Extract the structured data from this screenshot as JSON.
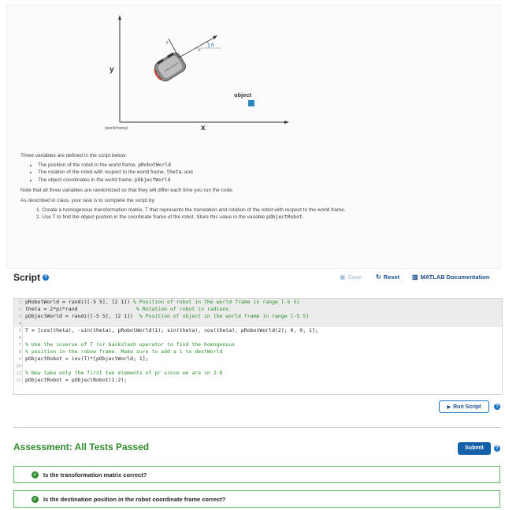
{
  "diagram": {
    "y_axis_label": "y",
    "x_axis_label": "x",
    "world_frame_label": "(world frame)",
    "object_label": "object",
    "robot_label": "(robot frame)",
    "theta_symbol": "θ",
    "robot_y_label": "y",
    "robot_x_label": "x"
  },
  "intro": {
    "p1": "Three variables are defined in the script below:",
    "bullets": [
      {
        "text": "The position of the robot in the world frame, ",
        "code": "pRobotWorld",
        "tail": ""
      },
      {
        "text": "The rotation of the robot with respect to the world frame, ",
        "code": "theta",
        "tail": ", and"
      },
      {
        "text": "The object coordinates in the world frame, ",
        "code": "pObjectWorld",
        "tail": ""
      }
    ],
    "p2": "Note that all three variables are randomized so that they will differ each time you run the code.",
    "p3": "As described in class, your task is to complete the script by:",
    "steps": [
      {
        "n": "1.",
        "text": "Create a homogenous transformation matrix, ",
        "code": "T",
        "tail": " that represents the translation and rotation of the robot with respect to the world frame."
      },
      {
        "n": "2.",
        "text": "Use ",
        "code": "T",
        "tail": " to find the object postion in the coordinate frame of the robot. Store this value in the variable ",
        "code2": "pObjectRobot",
        "tail2": "."
      }
    ]
  },
  "script": {
    "title": "Script",
    "save_label": "Save",
    "reset_label": "Reset",
    "doc_label": "MATLAB Documentation",
    "run_label": "Run Script",
    "lines": [
      {
        "n": "1",
        "code": "pRobotWorld = randi([-5 5], [2 1]) ",
        "comment": "% Position of robot in the world frame in range [-5 5]",
        "locked": true
      },
      {
        "n": "2",
        "code": "theta = 2*pi*rand                   ",
        "comment": "% Rotation of robot in radians",
        "locked": true
      },
      {
        "n": "3",
        "code": "pObjectWorld = randi([-5 5], [2 1])  ",
        "comment": "% Position of object in the world frame in range [-5 5]",
        "locked": true
      },
      {
        "n": "4",
        "code": "",
        "comment": "",
        "locked": true
      },
      {
        "n": "5",
        "code": "T = [cos(theta), -sin(theta), pRobotWorld(1); sin(theta), cos(theta), pRobotWorld(2); 0, 0, 1];",
        "comment": "",
        "locked": false
      },
      {
        "n": "6",
        "code": "",
        "comment": "",
        "locked": false
      },
      {
        "n": "7",
        "code": "",
        "comment": "% Use the inverse of T (or backslash operator to find the homogenous",
        "locked": false
      },
      {
        "n": "8",
        "code": "",
        "comment": "% position in the robow frame. Make sure to add a 1 to destWorld",
        "locked": false
      },
      {
        "n": "9",
        "code": "pObjectRobot = inv(T)*[pObjectWorld; 1];",
        "comment": "",
        "locked": false
      },
      {
        "n": "10",
        "code": "",
        "comment": "",
        "locked": false
      },
      {
        "n": "11",
        "code": "",
        "comment": "% Now take only the first two elements of pr since we are in 2-D",
        "locked": false
      },
      {
        "n": "12",
        "code": "pObjectRobot = pObjectRobot(1:2);",
        "comment": "",
        "locked": false
      }
    ]
  },
  "assessment": {
    "title": "Assessment: All Tests Passed",
    "submit_label": "Submit",
    "tests": [
      "Is the transformation matrix correct?",
      "Is the destination position in the robot coordinate frame correct?"
    ]
  },
  "colors": {
    "accent": "#1a73c6",
    "pass_green": "#2e8b2e",
    "submit_blue": "#1560a8"
  },
  "icons": {
    "help": "question-circle-icon",
    "save": "floppy-disk-icon",
    "reset": "refresh-icon",
    "doc": "book-icon",
    "run": "play-icon",
    "check": "check-circle-icon"
  }
}
